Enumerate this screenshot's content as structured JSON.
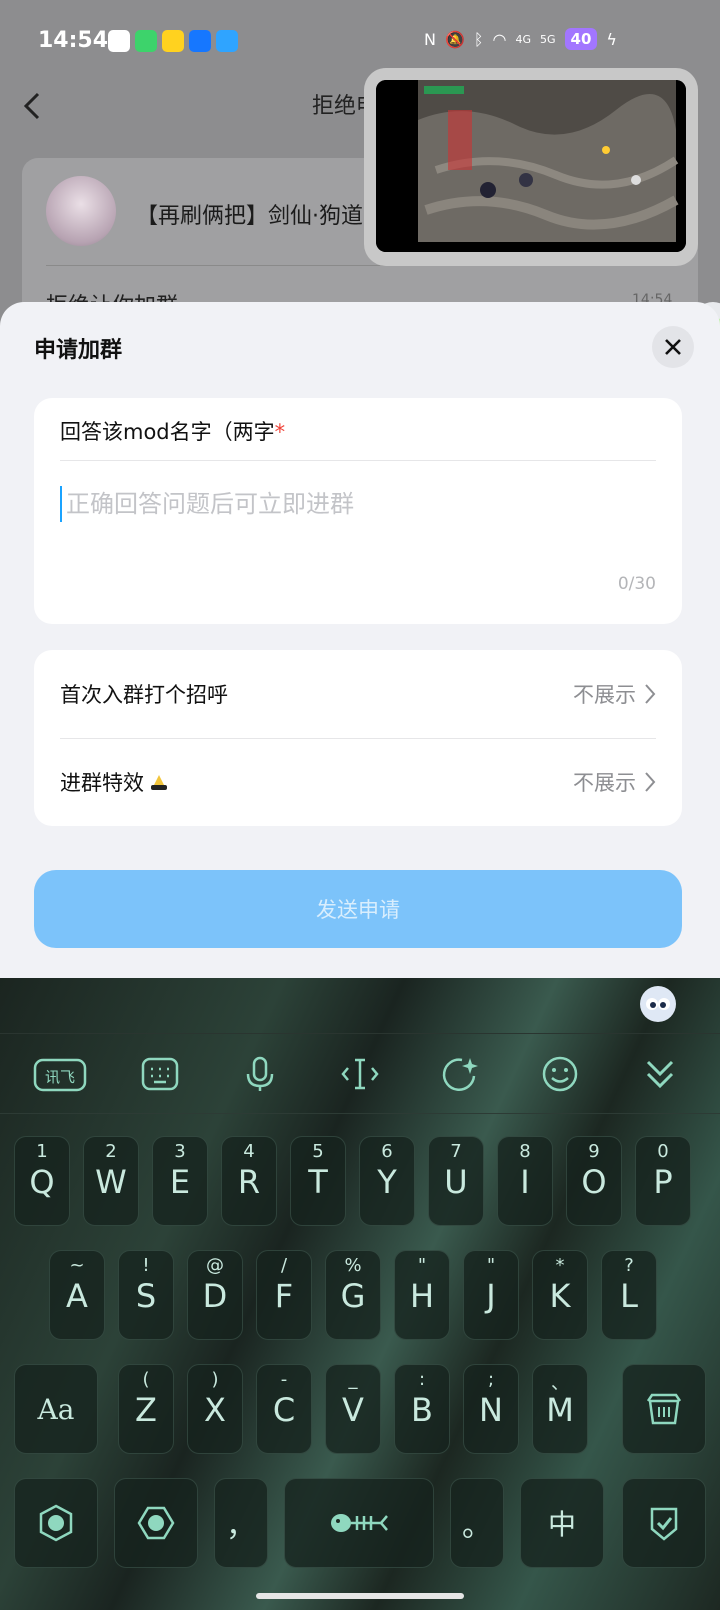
{
  "status_bar": {
    "time": "14:54",
    "battery": "40",
    "net1": "4G",
    "net2": "5G"
  },
  "background": {
    "nav_title": "拒绝申",
    "group_name": "【再刷俩把】剑仙·狗道",
    "message": "拒绝让你加群",
    "message_time": "14:54"
  },
  "sheet": {
    "title": "申请加群",
    "question": {
      "label": "回答该mod名字（两字",
      "required_mark": "*",
      "placeholder": "正确回答问题后可立即进群",
      "counter": "0/30"
    },
    "options": [
      {
        "label": "首次入群打个招呼",
        "value": "不展示"
      },
      {
        "label": "进群特效",
        "value": "不展示"
      }
    ],
    "submit_label": "发送申请"
  },
  "keyboard": {
    "row1": [
      {
        "main": "Q",
        "sub": "1"
      },
      {
        "main": "W",
        "sub": "2"
      },
      {
        "main": "E",
        "sub": "3"
      },
      {
        "main": "R",
        "sub": "4"
      },
      {
        "main": "T",
        "sub": "5"
      },
      {
        "main": "Y",
        "sub": "6"
      },
      {
        "main": "U",
        "sub": "7"
      },
      {
        "main": "I",
        "sub": "8"
      },
      {
        "main": "O",
        "sub": "9"
      },
      {
        "main": "P",
        "sub": "0"
      }
    ],
    "row2": [
      {
        "main": "A",
        "sub": "~"
      },
      {
        "main": "S",
        "sub": "!"
      },
      {
        "main": "D",
        "sub": "@"
      },
      {
        "main": "F",
        "sub": "/"
      },
      {
        "main": "G",
        "sub": "%"
      },
      {
        "main": "H",
        "sub": "\""
      },
      {
        "main": "J",
        "sub": "\""
      },
      {
        "main": "K",
        "sub": "*"
      },
      {
        "main": "L",
        "sub": "?"
      }
    ],
    "row3": [
      {
        "main": "Z",
        "sub": "("
      },
      {
        "main": "X",
        "sub": ")"
      },
      {
        "main": "C",
        "sub": "-"
      },
      {
        "main": "V",
        "sub": "_"
      },
      {
        "main": "B",
        "sub": ":"
      },
      {
        "main": "N",
        "sub": ";"
      },
      {
        "main": "M",
        "sub": "、"
      }
    ],
    "comma": "，",
    "period": "。",
    "lang": "中",
    "caps_label": "Aa",
    "toolbar_logo": "讯飞"
  }
}
